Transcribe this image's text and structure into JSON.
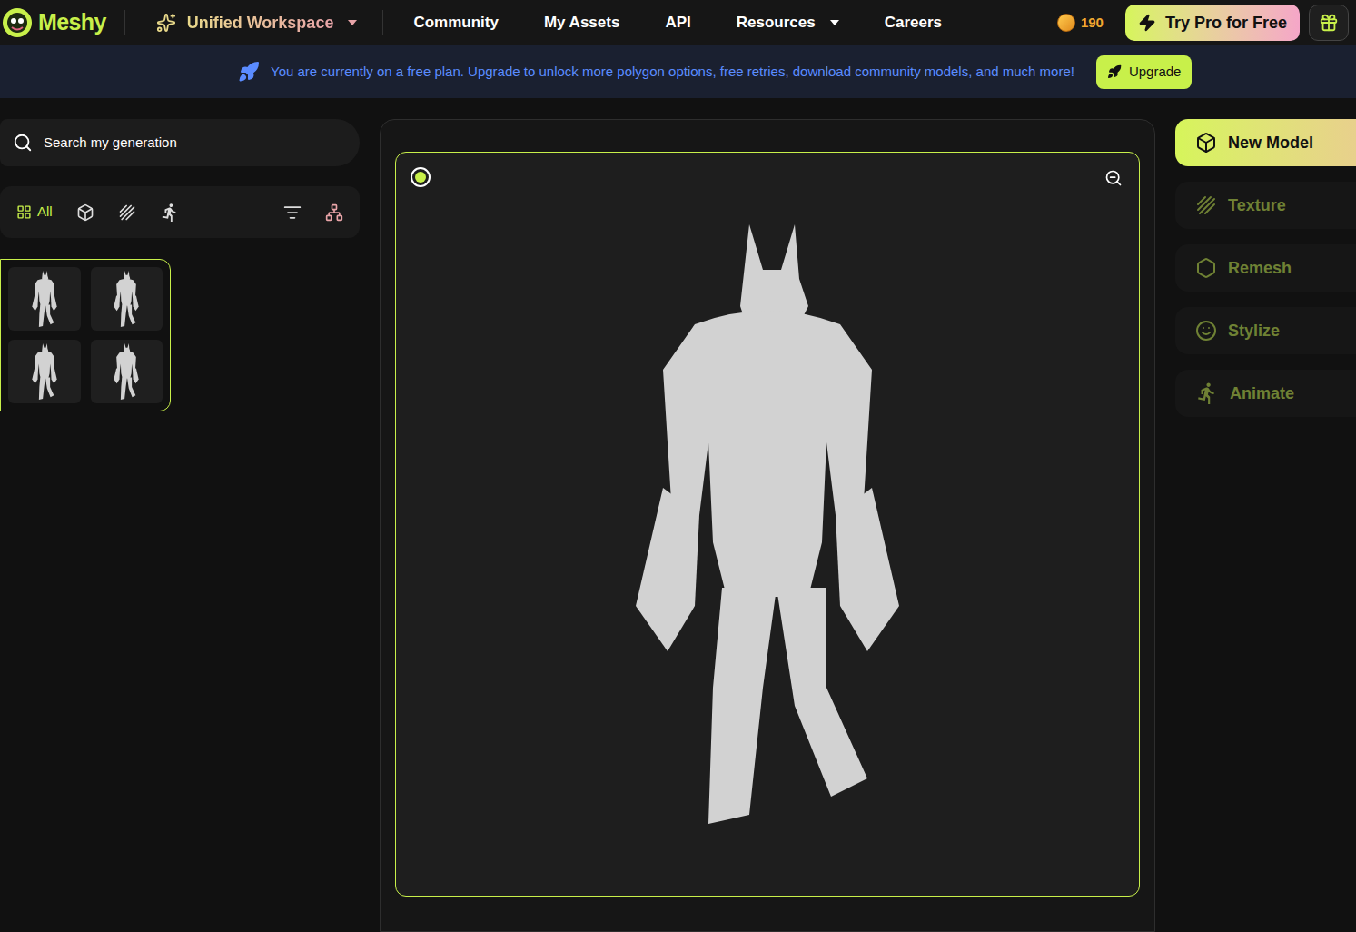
{
  "nav": {
    "logo": "Meshy",
    "workspace": "Unified Workspace",
    "links": [
      {
        "label": "Community",
        "dropdown": false
      },
      {
        "label": "My Assets",
        "dropdown": false
      },
      {
        "label": "API",
        "dropdown": false
      },
      {
        "label": "Resources",
        "dropdown": true
      },
      {
        "label": "Careers",
        "dropdown": false
      }
    ],
    "credits": "190",
    "pro_button": "Try Pro for Free"
  },
  "banner": {
    "text": "You are currently on a free plan. Upgrade to unlock more polygon options, free retries, download community models, and much more!",
    "button": "Upgrade"
  },
  "search": {
    "placeholder": "Search my generation"
  },
  "filters": [
    {
      "kind": "all",
      "label": "All",
      "selected": true
    },
    {
      "kind": "model",
      "label": "",
      "selected": false
    },
    {
      "kind": "texture",
      "label": "",
      "selected": false
    },
    {
      "kind": "animation",
      "label": "",
      "selected": false
    }
  ],
  "generations": [
    {
      "selected": true,
      "thumbnails": [
        {
          "selected": false
        },
        {
          "selected": false
        },
        {
          "selected": false
        },
        {
          "selected": false
        }
      ]
    }
  ],
  "viewer": {
    "radio_selected": true
  },
  "tools": [
    {
      "kind": "new-model",
      "label": "New Model",
      "selected": true
    },
    {
      "kind": "texture",
      "label": "Texture",
      "selected": false
    },
    {
      "kind": "remesh",
      "label": "Remesh",
      "selected": false
    },
    {
      "kind": "stylize",
      "label": "Stylize",
      "selected": false
    },
    {
      "kind": "animate",
      "label": "Animate",
      "selected": false
    }
  ]
}
